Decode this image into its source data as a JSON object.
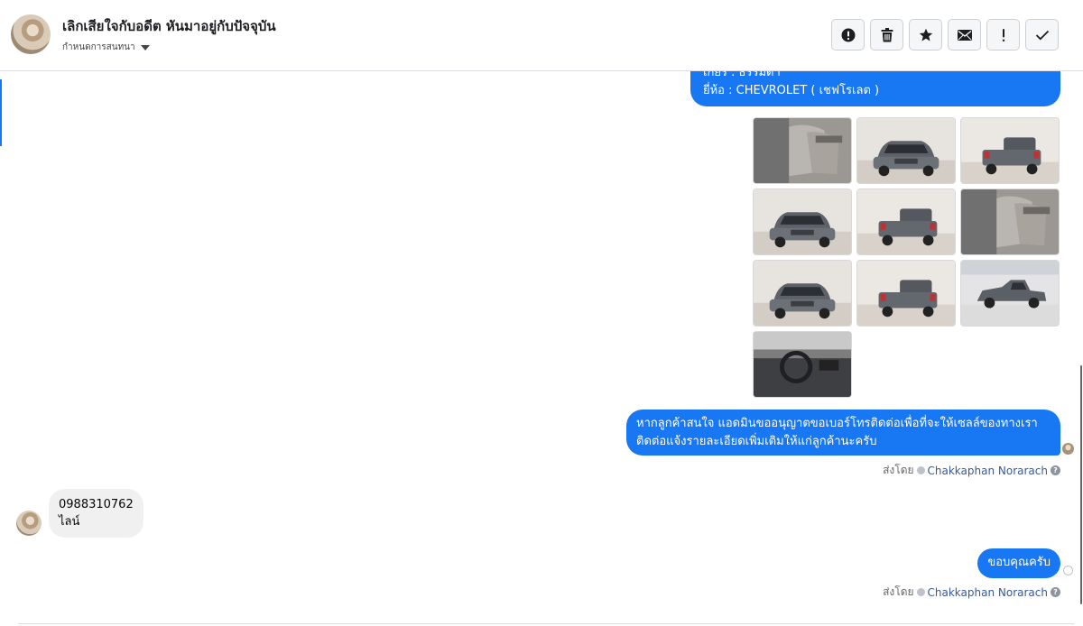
{
  "header": {
    "title": "เลิกเสียใจกับอดีต หันมาอยู่กับปัจจุบัน",
    "subtitle": "กำหนดการสนทนา",
    "actions": [
      {
        "name": "report-button",
        "icon": "alert-circle-icon",
        "label": "Report"
      },
      {
        "name": "delete-button",
        "icon": "trash-icon",
        "label": "Delete"
      },
      {
        "name": "star-button",
        "icon": "star-icon",
        "label": "Star"
      },
      {
        "name": "mark-unread-button",
        "icon": "envelope-icon",
        "label": "Mark unread"
      },
      {
        "name": "important-button",
        "icon": "exclamation-icon",
        "label": "Important"
      },
      {
        "name": "done-button",
        "icon": "check-icon",
        "label": "Done"
      }
    ]
  },
  "messages": {
    "spec_partial": {
      "line1": "เกียร์ : ธรรมดา",
      "line2": "ยี่ห้อ : CHEVROLET ( เชฟโรเลต )"
    },
    "photos": [
      {
        "name": "photo-interior-seat",
        "kind": "interior"
      },
      {
        "name": "photo-front-view",
        "kind": "front"
      },
      {
        "name": "photo-rear-view",
        "kind": "rear"
      },
      {
        "name": "photo-front-quarter",
        "kind": "front"
      },
      {
        "name": "photo-rear-quarter",
        "kind": "rear"
      },
      {
        "name": "photo-rear-seat",
        "kind": "interior"
      },
      {
        "name": "photo-front-angle",
        "kind": "front"
      },
      {
        "name": "photo-rear-straight",
        "kind": "rear"
      },
      {
        "name": "photo-side-view",
        "kind": "side"
      },
      {
        "name": "photo-dashboard",
        "kind": "dash"
      }
    ],
    "outgoing_1": {
      "line1": "หากลูกค้าสนใจ แอดมินขออนุญาตขอเบอร์โทรติดต่อเพื่อที่จะให้เซลล์ของทางเรา",
      "line2": "ติดต่อแจ้งรายละเอียดเพิ่มเติมให้แก่ลูกค้านะครับ"
    },
    "sent_by_1": {
      "prefix": "ส่งโดย",
      "name": "Chakkaphan Norarach",
      "help": "?"
    },
    "incoming_1": {
      "line1": "0988310762",
      "line2": "ไลน์"
    },
    "outgoing_2": {
      "text": "ขอบคุณครับ"
    },
    "sent_by_2": {
      "prefix": "ส่งโดย",
      "name": "Chakkaphan Norarach",
      "help": "?"
    }
  },
  "colors": {
    "accent": "#1877f2",
    "incoming_bubble": "#f0f0f0",
    "sender_link": "#385898"
  }
}
